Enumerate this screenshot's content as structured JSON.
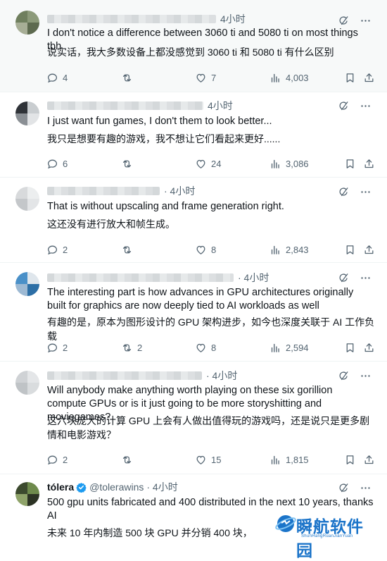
{
  "tweets": [
    {
      "time": "4小时",
      "text": "I don't notice a difference between 3060 ti and 5080 ti on most things tbh",
      "translation": "说实话，我大多数设备上都没感觉到 3060 ti 和 5080 ti 有什么区别",
      "replies": "4",
      "retweets": "",
      "likes": "7",
      "views": "4,003"
    },
    {
      "time": "4小时",
      "text": "I just want fun games, I don't them to look better...",
      "translation": "我只是想要有趣的游戏，我不想让它们看起来更好......",
      "replies": "6",
      "retweets": "",
      "likes": "24",
      "views": "3,086"
    },
    {
      "time": "· 4小时",
      "text": "That is without upscaling and frame generation right.",
      "translation": "这还没有进行放大和帧生成。",
      "replies": "2",
      "retweets": "",
      "likes": "8",
      "views": "2,843"
    },
    {
      "time": "· 4小时",
      "text": "The interesting part is how advances in GPU architectures originally built for graphics are now deeply tied to AI workloads as well",
      "translation": "有趣的是，原本为图形设计的 GPU 架构进步，如今也深度关联于 AI 工作负载",
      "replies": "2",
      "retweets": "2",
      "likes": "8",
      "views": "2,594"
    },
    {
      "time": "· 4小时",
      "text": "Will anybody make anything worth playing on these six gorillion compute GPUs or is it just going to be more storyshitting and moviegames?",
      "translation": "这六块庞大的计算 GPU 上会有人做出值得玩的游戏吗，还是说只是更多剧情和电影游戏？",
      "replies": "2",
      "retweets": "",
      "likes": "15",
      "views": "1,815"
    },
    {
      "name": "tólera",
      "handle": "@tolerawins",
      "time": "· 4小时",
      "text": "500 gpu units fabricated and 400 distributed in the next 10 years, thanks AI",
      "translation": "未来 10 年内制造 500 块 GPU 并分销 400 块，"
    }
  ],
  "watermark": {
    "main": "瞬航软件园",
    "sub": "ShunHangRuanJianYuan"
  },
  "colors": {
    "text": "#0f1419",
    "muted": "#536471",
    "verified": "#1d9bf0",
    "watermark": "#1b74c9"
  }
}
